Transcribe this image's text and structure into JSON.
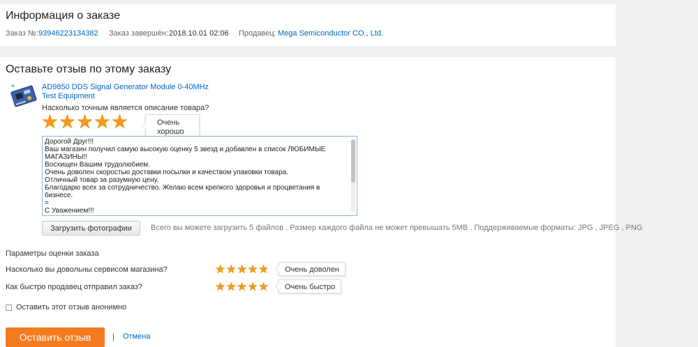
{
  "order": {
    "title": "Информация о заказе",
    "number_label": "Заказ №:",
    "number": "93946223134382",
    "completed_label": "Заказ завершён:",
    "completed": "2018.10.01 02:06",
    "seller_label": "Продавец:",
    "seller": "Mega Semiconductor CO., Ltd."
  },
  "review": {
    "title": "Оставьте отзыв по этому заказу",
    "product": {
      "name": "AD9850 DDS Signal Generator Module 0-40MHz",
      "category": "Test Equipment",
      "question": "Насколько точным является описание товара?",
      "rating": 5,
      "rating_max": 5,
      "rating_label": "Очень хорошо"
    },
    "text": "Дорогой Друг!!!\nВаш магазин получил самую высокую оценку 5 звезд и добавлен в список ЛЮБИМЫЕ\nМАГАЗИНЫ!!\nВосхищен Вашим трудолюбием.\nОчень доволен скоростью доставки посылки и качеством упаковки товара.\nОтличный товар за разумную цену.\nБлагодарю всех за сотрудничество. Желаю всем крепкого здоровья и процветания в бизнесе.\n=\nС Уважением!!!\nЗарубин Владимир\nСтрана Россия г. Саратов",
    "upload_button": "Загрузить фотографии",
    "upload_note": "Всего вы можете загрузить 5 файлов . Размер каждого файла не может превышать 5MB . Поддерживаемые форматы: JPG , JPEG , PNG"
  },
  "params": {
    "title": "Параметры оценки заказа",
    "items": [
      {
        "question": "Насколько вы довольны сервисом магазина?",
        "rating": 5,
        "rating_max": 5,
        "label": "Очень доволен"
      },
      {
        "question": "Как быстро продавец отправил заказ?",
        "rating": 5,
        "rating_max": 5,
        "label": "Очень быстро"
      }
    ]
  },
  "anonymous_label": "Оставить этот отзыв анонимно",
  "anonymous_checked": false,
  "submit_button": "Оставить отзыв",
  "separator": "|",
  "cancel_link": "Отмена",
  "colors": {
    "accent": "#f47b20",
    "star": "#f29a19",
    "link": "#0066c0"
  },
  "icons": {
    "star": "star-icon",
    "product": "product-thumbnail"
  }
}
